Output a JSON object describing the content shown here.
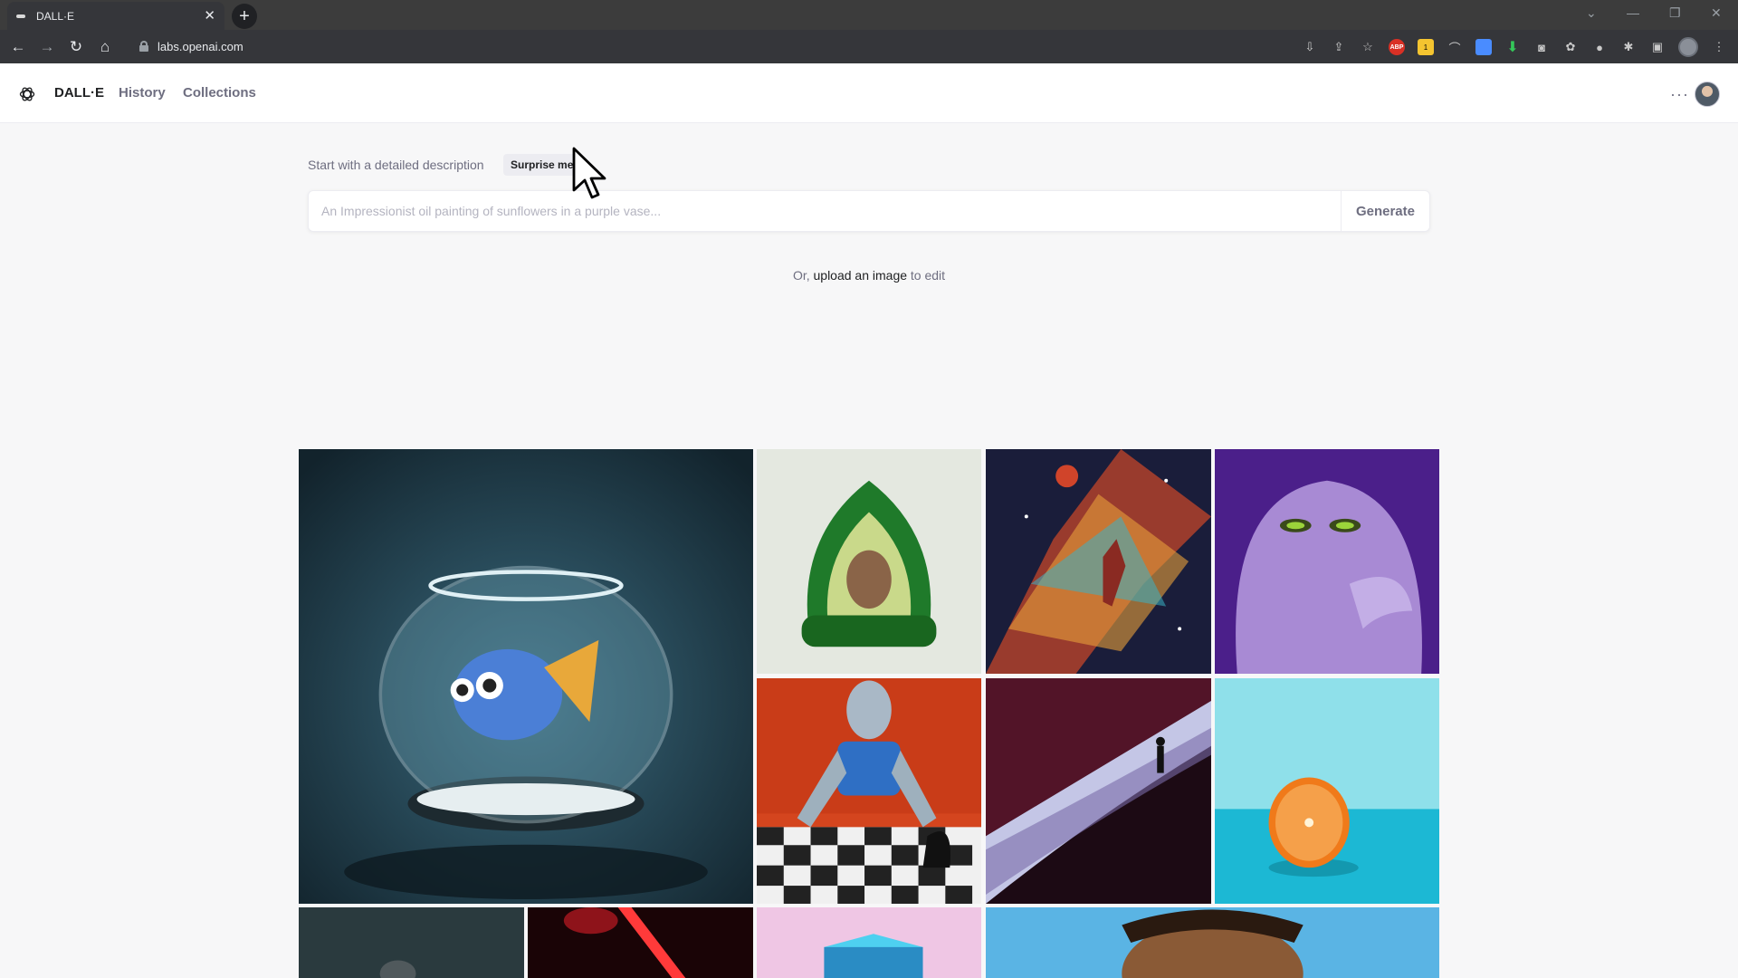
{
  "browser": {
    "tab_title": "DALL·E",
    "url": "labs.openai.com",
    "extensions": [
      "download-icon",
      "share-icon",
      "star-icon",
      "abp-icon",
      "extension-badge-icon",
      "extension-icon",
      "extension-icon",
      "download-arrow-icon",
      "camera-icon",
      "extension-icon",
      "extension-icon",
      "puzzle-icon",
      "sidebar-icon",
      "profile-avatar",
      "menu-icon"
    ],
    "abp_label": "ABP",
    "badge_count": "1"
  },
  "header": {
    "brand": "DALL·E",
    "nav": [
      "History",
      "Collections"
    ]
  },
  "prompt": {
    "label": "Start with a detailed description",
    "surprise_label": "Surprise me",
    "placeholder": "An Impressionist oil painting of sunflowers in a purple vase...",
    "generate_label": "Generate",
    "upload_prefix": "Or, ",
    "upload_link": "upload an image",
    "upload_suffix": " to edit"
  },
  "gallery": {
    "images": [
      "goldfish-bowl-image",
      "avocado-armchair-image",
      "cosmic-basketball-image",
      "purple-monster-image",
      "robot-chess-image",
      "silhouette-wave-image",
      "orange-half-image",
      "astronaut-image",
      "neon-light-image",
      "cube-image",
      "portrait-painting-image"
    ]
  },
  "colors": {
    "page_bg": "#f7f7f8",
    "text_primary": "#202123",
    "text_secondary": "#6e6e80",
    "browser_dark": "#35363a"
  }
}
